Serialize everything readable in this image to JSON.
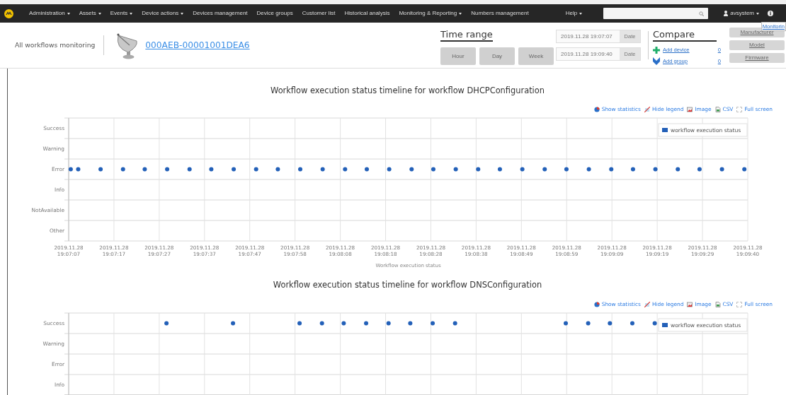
{
  "navbar": {
    "items": [
      {
        "label": "Administration",
        "dropdown": true
      },
      {
        "label": "Assets",
        "dropdown": true
      },
      {
        "label": "Events",
        "dropdown": true
      },
      {
        "label": "Device actions",
        "dropdown": true
      },
      {
        "label": "Devices management",
        "dropdown": false
      },
      {
        "label": "Device groups",
        "dropdown": false
      },
      {
        "label": "Customer list",
        "dropdown": false
      },
      {
        "label": "Historical analysis",
        "dropdown": false
      },
      {
        "label": "Monitoring & Reporting",
        "dropdown": true
      },
      {
        "label": "Numbers management",
        "dropdown": false
      }
    ],
    "help": {
      "label": "Help",
      "dropdown": true
    },
    "user": {
      "label": "avsystem",
      "dropdown": true
    }
  },
  "header": {
    "page_title": "All workflows monitoring",
    "device_id": "000AEB-00001001DEA6",
    "time_range": {
      "title": "Time range",
      "buttons": [
        {
          "label": "Hour",
          "disabled": true
        },
        {
          "label": "Day",
          "disabled": true
        },
        {
          "label": "Week",
          "disabled": true
        }
      ],
      "dates": [
        {
          "value": "2019.11.28 19:07:07",
          "button": "Date"
        },
        {
          "value": "2019.11.28 19:09:40",
          "button": "Date"
        }
      ]
    },
    "compare": {
      "title": "Compare",
      "links": [
        {
          "kind": "device",
          "label": "Add device",
          "count": "0"
        },
        {
          "kind": "group",
          "label": "Add group",
          "count": "0"
        }
      ]
    },
    "filters": [
      {
        "label": "Manufacturer",
        "disabled": true
      },
      {
        "label": "Model",
        "disabled": true
      },
      {
        "label": "Firmware",
        "disabled": true
      }
    ],
    "tooltip_link": "Monitorin"
  },
  "charts": [
    {
      "title": "Workflow execution status timeline for workflow DHCPConfiguration",
      "toolbar": [
        {
          "kind": "statistics",
          "label": "Show statistics"
        },
        {
          "kind": "legend",
          "label": "Hide legend"
        },
        {
          "kind": "image",
          "label": "Image"
        },
        {
          "kind": "csv",
          "label": "CSV"
        },
        {
          "kind": "fullscreen",
          "label": "Full screen"
        }
      ],
      "legend": "workflow execution status",
      "y_axis_labels": [
        "Success",
        "Warning",
        "Error",
        "Info",
        "NotAvailable",
        "Other"
      ],
      "x_axis_labels": [
        "2019.11.28 19:07:07",
        "2019.11.28 19:07:17",
        "2019.11.28 19:07:27",
        "2019.11.28 19:07:37",
        "2019.11.28 19:07:47",
        "2019.11.28 19:07:58",
        "2019.11.28 19:08:08",
        "2019.11.28 19:08:18",
        "2019.11.28 19:08:28",
        "2019.11.28 19:08:38",
        "2019.11.28 19:08:49",
        "2019.11.28 19:08:59",
        "2019.11.28 19:09:09",
        "2019.11.28 19:09:19",
        "2019.11.28 19:09:29",
        "2019.11.28 19:09:40"
      ],
      "x_axis_title": "Workflow execution status"
    },
    {
      "title": "Workflow execution status timeline for workflow DNSConfiguration",
      "toolbar": [
        {
          "kind": "statistics",
          "label": "Show statistics"
        },
        {
          "kind": "legend",
          "label": "Hide legend"
        },
        {
          "kind": "image",
          "label": "Image"
        },
        {
          "kind": "csv",
          "label": "CSV"
        },
        {
          "kind": "fullscreen",
          "label": "Full screen"
        }
      ],
      "legend": "workflow execution status",
      "y_axis_labels": [
        "Success",
        "Warning",
        "Error",
        "Info"
      ]
    }
  ]
}
